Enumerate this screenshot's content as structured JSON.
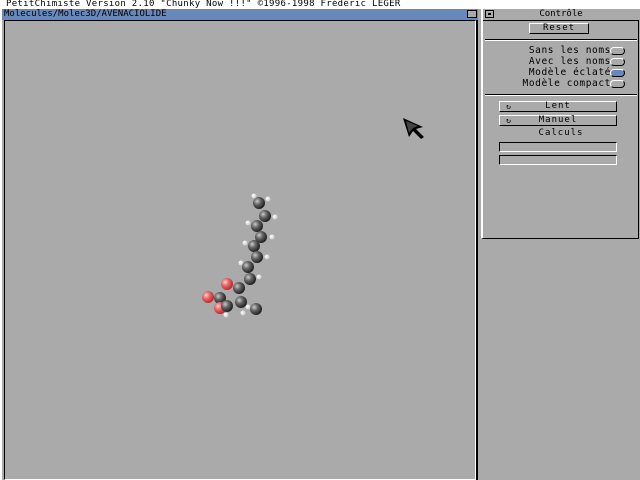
{
  "screen_title": "PetitChimiste Version 2.10 \"Chunky Now !!!\" ©1996-1998 Frédéric LEGER",
  "viewer": {
    "title": "Molecules/Molec3D/AVENACIOLIDE"
  },
  "control": {
    "title": "Contrôle",
    "reset_label": "Reset",
    "options": [
      {
        "label": "Sans les noms",
        "on": false
      },
      {
        "label": "Avec les noms",
        "on": false
      },
      {
        "label": "Modèle éclaté",
        "on": true
      },
      {
        "label": "Modèle compact",
        "on": false
      }
    ],
    "speed_label": "Lent",
    "mode_label": "Manuel",
    "calculs_label": "Calculs",
    "field1_value": "",
    "field2_value": ""
  },
  "colors": {
    "background": "#aaaaaa",
    "carbon": "#555555",
    "oxygen": "#ee6666",
    "hydrogen": "#ffffff",
    "window_title_active": "#6688bb"
  }
}
